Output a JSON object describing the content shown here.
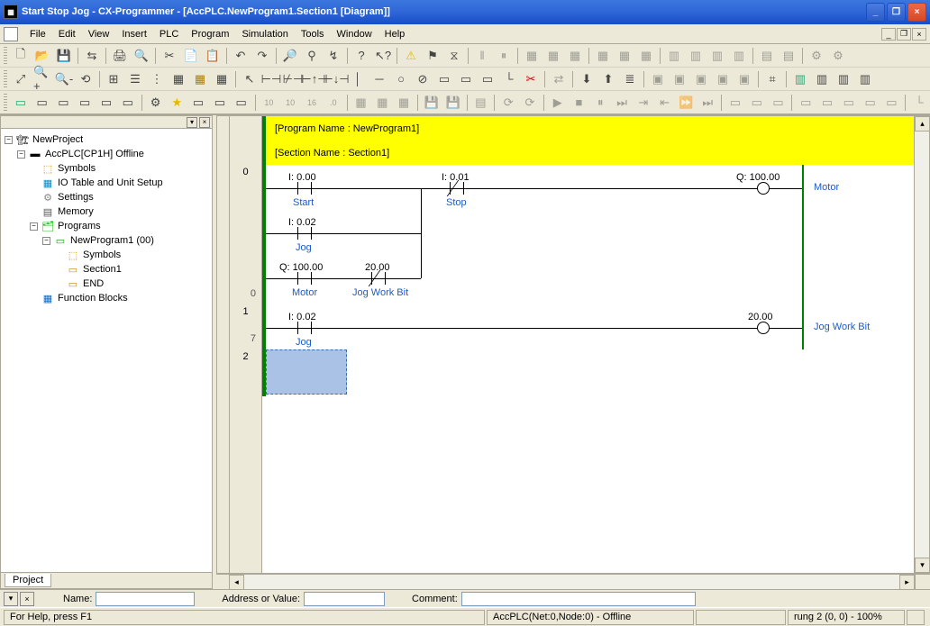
{
  "title": "Start Stop Jog - CX-Programmer - [AccPLC.NewProgram1.Section1 [Diagram]]",
  "menu": [
    "File",
    "Edit",
    "View",
    "Insert",
    "PLC",
    "Program",
    "Simulation",
    "Tools",
    "Window",
    "Help"
  ],
  "tree": {
    "root": "NewProject",
    "plc": "AccPLC[CP1H] Offline",
    "nodes": {
      "symbols": "Symbols",
      "io": "IO Table and Unit Setup",
      "settings": "Settings",
      "memory": "Memory",
      "programs": "Programs",
      "prog1": "NewProgram1 (00)",
      "p_symbols": "Symbols",
      "p_section1": "Section1",
      "p_end": "END",
      "fb": "Function Blocks"
    }
  },
  "project_tab": "Project",
  "ladder": {
    "program_name_line": "[Program Name : NewProgram1]",
    "section_name_line": "[Section Name : Section1]",
    "rung0": {
      "num": "0",
      "step": "0",
      "start": {
        "addr": "I: 0.00",
        "name": "Start"
      },
      "stop": {
        "addr": "I: 0.01",
        "name": "Stop"
      },
      "jog": {
        "addr": "I: 0.02",
        "name": "Jog"
      },
      "motor_in": {
        "addr": "Q: 100.00",
        "name": "Motor"
      },
      "jogbit": {
        "addr": "20.00",
        "name": "Jog Work Bit"
      },
      "coil": {
        "addr": "Q: 100.00",
        "name": "Motor"
      }
    },
    "rung1": {
      "num": "1",
      "step": "7",
      "jog": {
        "addr": "I: 0.02",
        "name": "Jog"
      },
      "coil": {
        "addr": "20.00",
        "name": "Jog Work Bit"
      }
    },
    "rung2": {
      "num": "2"
    }
  },
  "dock": {
    "name_lbl": "Name:",
    "addr_lbl": "Address or Value:",
    "comment_lbl": "Comment:"
  },
  "status": {
    "help": "For Help, press F1",
    "plc": "AccPLC(Net:0,Node:0) - Offline",
    "rung": "rung 2 (0, 0) - 100%"
  }
}
